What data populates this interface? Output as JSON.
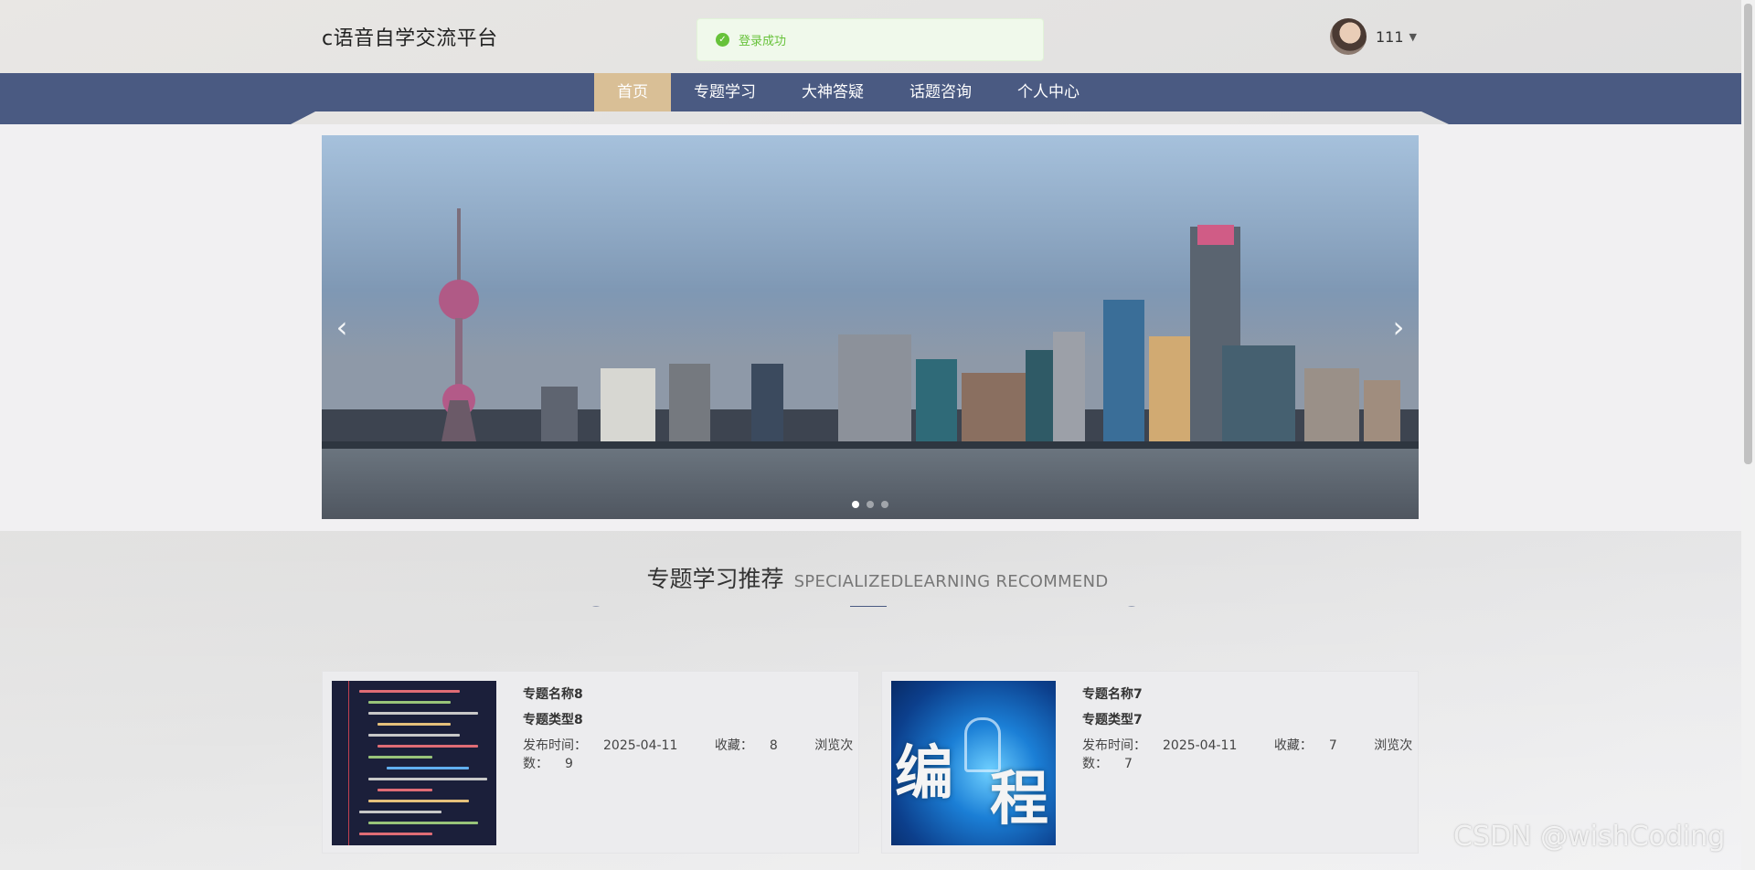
{
  "header": {
    "site_title": "c语音自学交流平台",
    "toast": "登录成功",
    "username": "111"
  },
  "nav": {
    "items": [
      {
        "label": "首页",
        "active": true
      },
      {
        "label": "专题学习",
        "active": false
      },
      {
        "label": "大神答疑",
        "active": false
      },
      {
        "label": "话题咨询",
        "active": false
      },
      {
        "label": "个人中心",
        "active": false
      }
    ]
  },
  "carousel": {
    "slide_count": 3,
    "active_slide": 1
  },
  "section": {
    "title_cn": "专题学习推荐",
    "title_en": "SPECIALIZEDLEARNING RECOMMEND"
  },
  "cards": [
    {
      "name": "专题名称8",
      "type": "专题类型8",
      "publish_label": "发布时间：",
      "publish_date": "2025-04-11",
      "fav_label": "收藏：",
      "fav_count": "8",
      "views_label": "浏览次数：",
      "views_count": "9"
    },
    {
      "name": "专题名称7",
      "type": "专题类型7",
      "publish_label": "发布时间：",
      "publish_date": "2025-04-11",
      "fav_label": "收藏：",
      "fav_count": "7",
      "views_label": "浏览次数：",
      "views_count": "7"
    }
  ],
  "thumb2_text": [
    "编",
    "程"
  ],
  "watermark": "CSDN @wishCoding",
  "colors": {
    "nav_bg": "#4a5a82",
    "nav_active": "#d9bf96",
    "toast_text": "#67c23a"
  }
}
